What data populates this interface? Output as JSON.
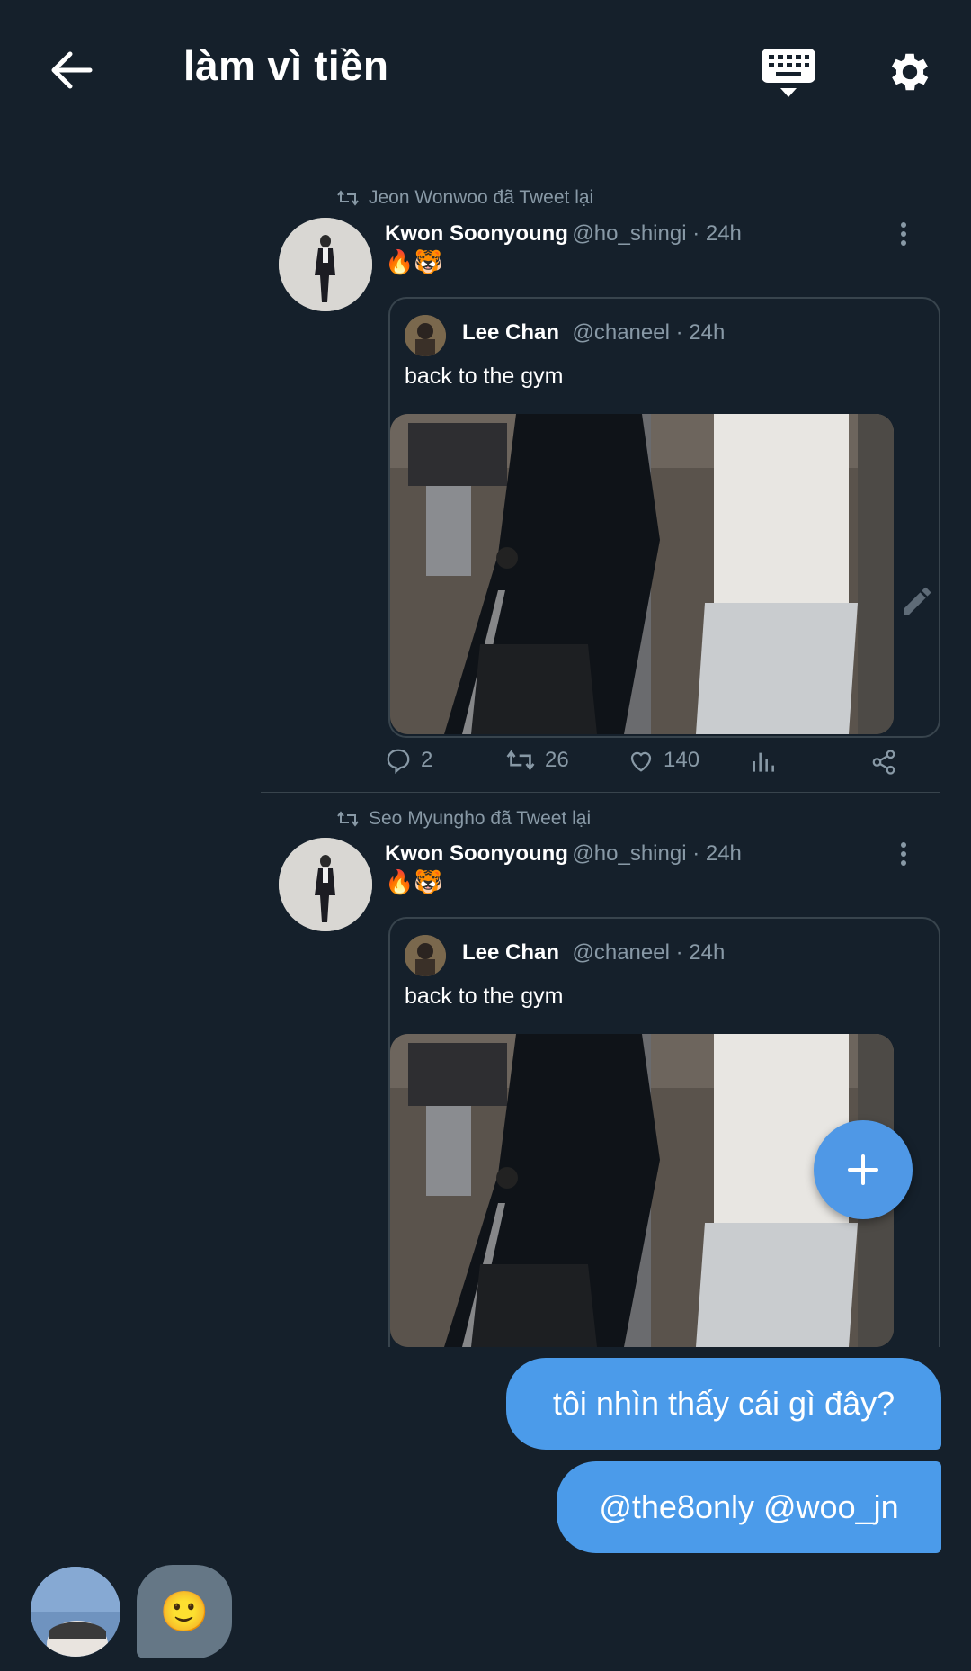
{
  "header": {
    "title": "làm vì tiền",
    "back_icon": "arrow-left-icon",
    "keyboard_icon": "keyboard-icon",
    "settings_icon": "gear-icon"
  },
  "tweets": [
    {
      "retweeted_by": "Jeon Wonwoo đã Tweet lại",
      "author_name": "Kwon Soonyoung",
      "author_meta": "@ho_shingi · 24h",
      "text": "🔥🐯",
      "quote": {
        "name": "Lee Chan",
        "meta": "@chaneel · 24h",
        "text": "back to the gym"
      },
      "replies": "2",
      "retweets": "26",
      "likes": "140"
    },
    {
      "retweeted_by": "Seo Myungho đã Tweet lại",
      "author_name": "Kwon Soonyoung",
      "author_meta": "@ho_shingi · 24h",
      "text": "🔥🐯",
      "quote": {
        "name": "Lee Chan",
        "meta": "@chaneel · 24h",
        "text": "back to the gym"
      }
    }
  ],
  "messages": [
    {
      "text": "tôi nhìn thấy cái gì đây?"
    },
    {
      "text": "@the8only @woo_jn"
    }
  ],
  "typing": {
    "emoji": "🙂"
  },
  "fab": {
    "label": "+"
  },
  "colors": {
    "background": "#15202b",
    "accent": "#4b9bea",
    "muted": "#8899a6",
    "border": "#38444d"
  }
}
